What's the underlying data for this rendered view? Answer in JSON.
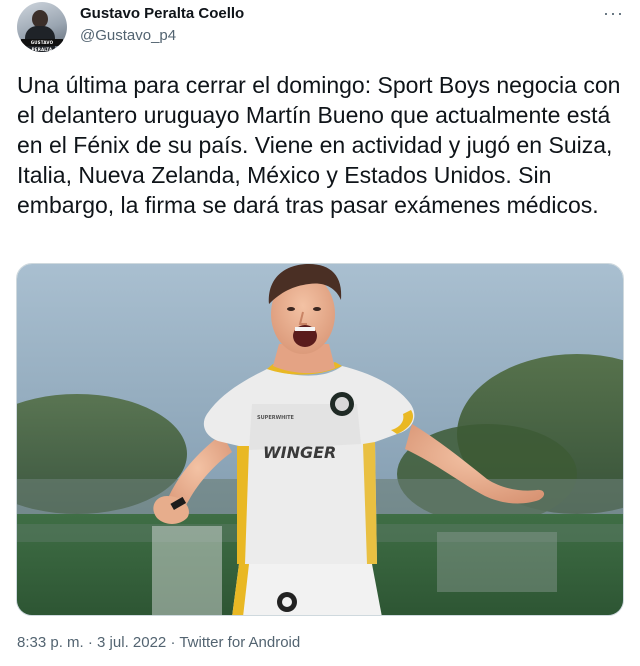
{
  "author": {
    "name": "Gustavo Peralta Coello",
    "handle": "@Gustavo_p4",
    "avatar_caption": "GUSTAVO PERALTA"
  },
  "more_icon": "more-horizontal-icon",
  "tweet": {
    "text": "Una última para cerrar el domingo: Sport Boys negocia con el delantero uruguayo Martín Bueno que actualmente está en el Fénix de su país. Viene en actividad y jugó en Suiza, Italia, Nueva Zelanda, México y Estados Unidos. Sin embargo, la firma se dará tras pasar exámenes médicos."
  },
  "media": {
    "jersey_sponsor": "WINGER",
    "jersey_small_text": "SUPERWHITE"
  },
  "meta": {
    "time": "8:33 p. m.",
    "separator": " · ",
    "date": "3 jul. 2022",
    "source": "Twitter for Android"
  },
  "colors": {
    "text": "#0f1419",
    "secondary": "#536471",
    "jersey": "#eeeeee",
    "jersey_trim": "#e9b824"
  }
}
